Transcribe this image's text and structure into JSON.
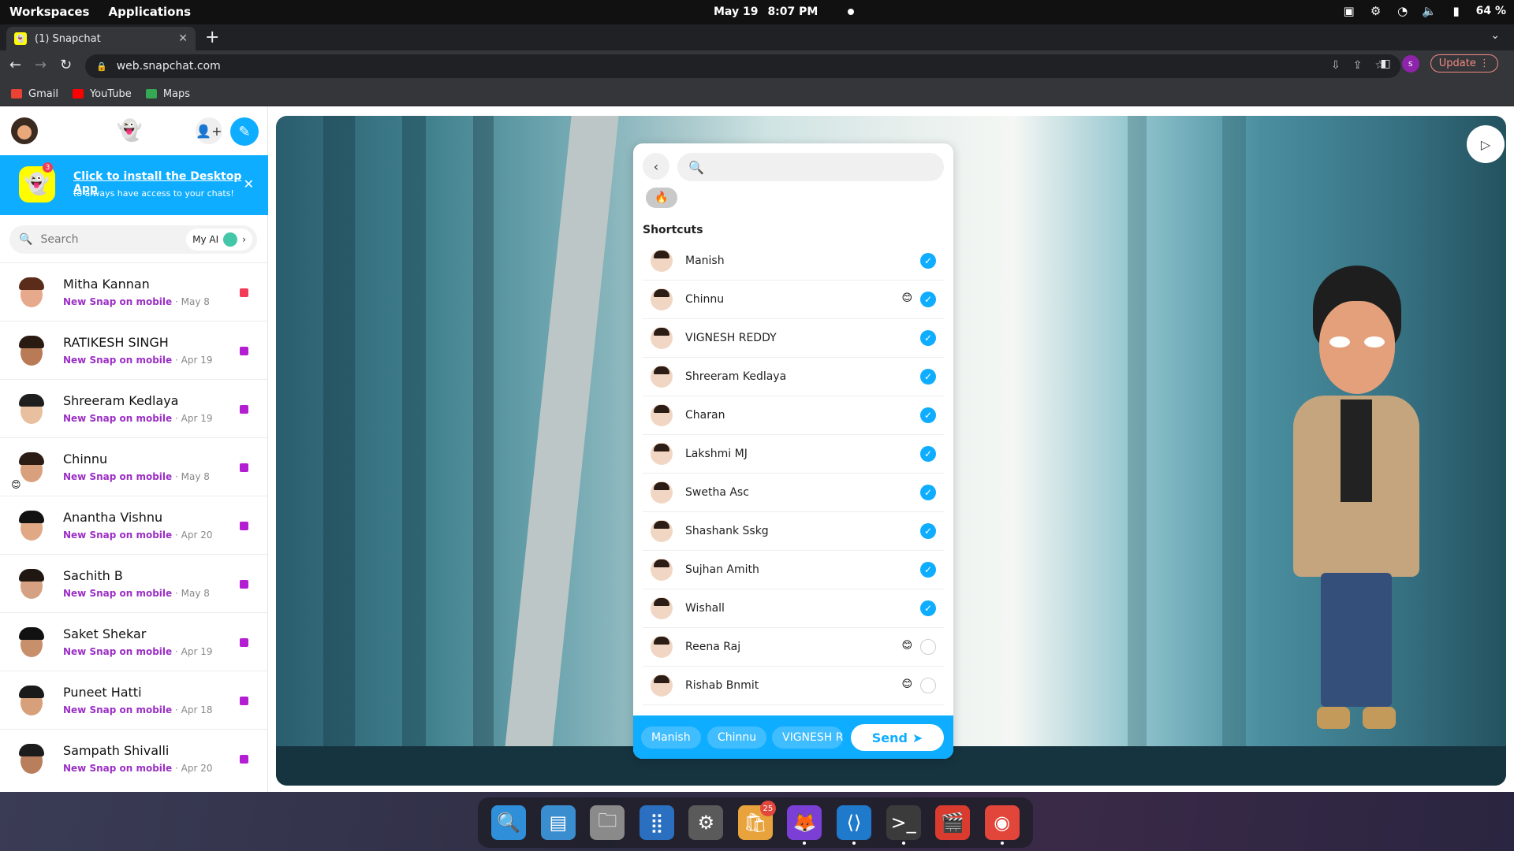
{
  "system": {
    "workspaces": "Workspaces",
    "applications": "Applications",
    "date": "May 19",
    "time": "8:07 PM",
    "battery": "64 %"
  },
  "browser": {
    "tab_title": "(1) Snapchat",
    "url": "web.snapchat.com",
    "update_label": "Update",
    "profile_initial": "s",
    "bookmarks": [
      {
        "label": "Gmail",
        "color": "#ea4335"
      },
      {
        "label": "YouTube",
        "color": "#ff0000"
      },
      {
        "label": "Maps",
        "color": "#34a853"
      }
    ]
  },
  "banner": {
    "title": "Click to install the Desktop App",
    "subtitle": "to always have access to your chats!",
    "badge_count": "3"
  },
  "search": {
    "placeholder": "Search",
    "my_ai_label": "My AI"
  },
  "chats": [
    {
      "name": "Mitha Kannan",
      "status": "New Snap on mobile",
      "date": "May 8",
      "status_color": "#f23c57",
      "emoji": ""
    },
    {
      "name": "RATIKESH SINGH",
      "status": "New Snap on mobile",
      "date": "Apr 19",
      "status_color": "#b41ed2",
      "emoji": ""
    },
    {
      "name": "Shreeram Kedlaya",
      "status": "New Snap on mobile",
      "date": "Apr 19",
      "status_color": "#b41ed2",
      "emoji": ""
    },
    {
      "name": "Chinnu",
      "status": "New Snap on mobile",
      "date": "May 8",
      "status_color": "#b41ed2",
      "emoji": "😊"
    },
    {
      "name": "Anantha Vishnu",
      "status": "New Snap on mobile",
      "date": "Apr 20",
      "status_color": "#b41ed2",
      "emoji": ""
    },
    {
      "name": "Sachith B",
      "status": "New Snap on mobile",
      "date": "May 8",
      "status_color": "#b41ed2",
      "emoji": ""
    },
    {
      "name": "Saket Shekar",
      "status": "New Snap on mobile",
      "date": "Apr 19",
      "status_color": "#b41ed2",
      "emoji": ""
    },
    {
      "name": "Puneet Hatti",
      "status": "New Snap on mobile",
      "date": "Apr 18",
      "status_color": "#b41ed2",
      "emoji": ""
    },
    {
      "name": "Sampath Shivalli",
      "status": "New Snap on mobile",
      "date": "Apr 20",
      "status_color": "#b41ed2",
      "emoji": ""
    }
  ],
  "share": {
    "fire_filter": "🔥",
    "shortcuts_label": "Shortcuts",
    "recipients": [
      {
        "name": "Manish",
        "emoji": "",
        "selected": true
      },
      {
        "name": "Chinnu",
        "emoji": "😊",
        "selected": true
      },
      {
        "name": "VIGNESH REDDY",
        "emoji": "",
        "selected": true
      },
      {
        "name": "Shreeram Kedlaya",
        "emoji": "",
        "selected": true
      },
      {
        "name": "Charan",
        "emoji": "",
        "selected": true
      },
      {
        "name": "Lakshmi MJ",
        "emoji": "",
        "selected": true
      },
      {
        "name": "Swetha Asc",
        "emoji": "",
        "selected": true
      },
      {
        "name": "Shashank Sskg",
        "emoji": "",
        "selected": true
      },
      {
        "name": "Sujhan Amith",
        "emoji": "",
        "selected": true
      },
      {
        "name": "Wishall",
        "emoji": "",
        "selected": true
      },
      {
        "name": "Reena Raj",
        "emoji": "😊",
        "selected": false
      },
      {
        "name": "Rishab Bnmit",
        "emoji": "😊",
        "selected": false
      }
    ],
    "chips": [
      "Manish",
      "Chinnu",
      "VIGNESH R"
    ],
    "send_label": "Send"
  },
  "dock": {
    "badge_count": "25",
    "apps": [
      {
        "name": "search-app-icon",
        "glyph": "🔍",
        "bg": "#2f8fd8",
        "running": false
      },
      {
        "name": "screenshot-app-icon",
        "glyph": "▤",
        "bg": "#3a8ed0",
        "running": false
      },
      {
        "name": "files-app-icon",
        "glyph": "🗀",
        "bg": "#8a8a8a",
        "running": false
      },
      {
        "name": "app-grid-icon",
        "glyph": "⣿",
        "bg": "#2a6fc0",
        "running": false
      },
      {
        "name": "settings-app-icon",
        "glyph": "⚙",
        "bg": "#5a5a5a",
        "running": false
      },
      {
        "name": "software-app-icon",
        "glyph": "🛍",
        "bg": "#e8a33d",
        "running": false
      },
      {
        "name": "firefox-app-icon",
        "glyph": "🦊",
        "bg": "#7b3fd6",
        "running": true
      },
      {
        "name": "vscode-app-icon",
        "glyph": "⟨⟩",
        "bg": "#1f7acc",
        "running": true
      },
      {
        "name": "terminal-app-icon",
        "glyph": ">_",
        "bg": "#3b3b3b",
        "running": true
      },
      {
        "name": "video-editor-app-icon",
        "glyph": "🎬",
        "bg": "#d93c2f",
        "running": false
      },
      {
        "name": "chrome-app-icon",
        "glyph": "◉",
        "bg": "#e2453a",
        "running": true
      }
    ]
  }
}
